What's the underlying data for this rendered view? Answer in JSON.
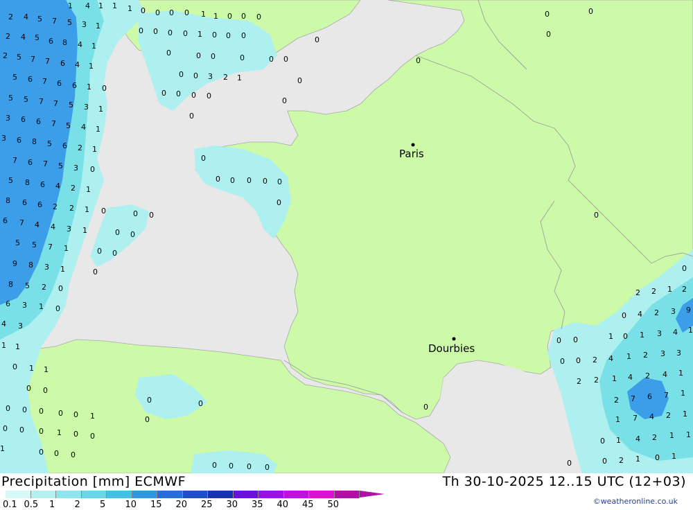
{
  "map": {
    "cities": [
      {
        "name": "Paris"
      },
      {
        "name": "Dourbies"
      }
    ],
    "colors": {
      "sea": "#e8e8e8",
      "land": "#ccfaa8",
      "precip_light": "#aef0f0",
      "precip_mid": "#78e0e6",
      "precip_heavy": "#3c9ee8",
      "borders": "#a0a0a0"
    }
  },
  "footer": {
    "title": "Precipitation [mm] ECMWF",
    "datetime": "Th 30-10-2025 12..15 UTC (12+03)",
    "credit": "©weatheronline.co.uk",
    "legend": [
      {
        "label": "0.1",
        "color": "#d8f8f8"
      },
      {
        "label": "0.5",
        "color": "#b4f0f0"
      },
      {
        "label": "1",
        "color": "#8ee6ec"
      },
      {
        "label": "2",
        "color": "#6ad6e6"
      },
      {
        "label": "5",
        "color": "#46c0e2"
      },
      {
        "label": "10",
        "color": "#3296de"
      },
      {
        "label": "15",
        "color": "#2470d8"
      },
      {
        "label": "20",
        "color": "#1e4ec8"
      },
      {
        "label": "25",
        "color": "#1a32b0"
      },
      {
        "label": "30",
        "color": "#6a10e0"
      },
      {
        "label": "35",
        "color": "#9a10e8"
      },
      {
        "label": "40",
        "color": "#c010e0"
      },
      {
        "label": "45",
        "color": "#e010d0"
      },
      {
        "label": "50",
        "color": "#b010a8"
      }
    ]
  }
}
